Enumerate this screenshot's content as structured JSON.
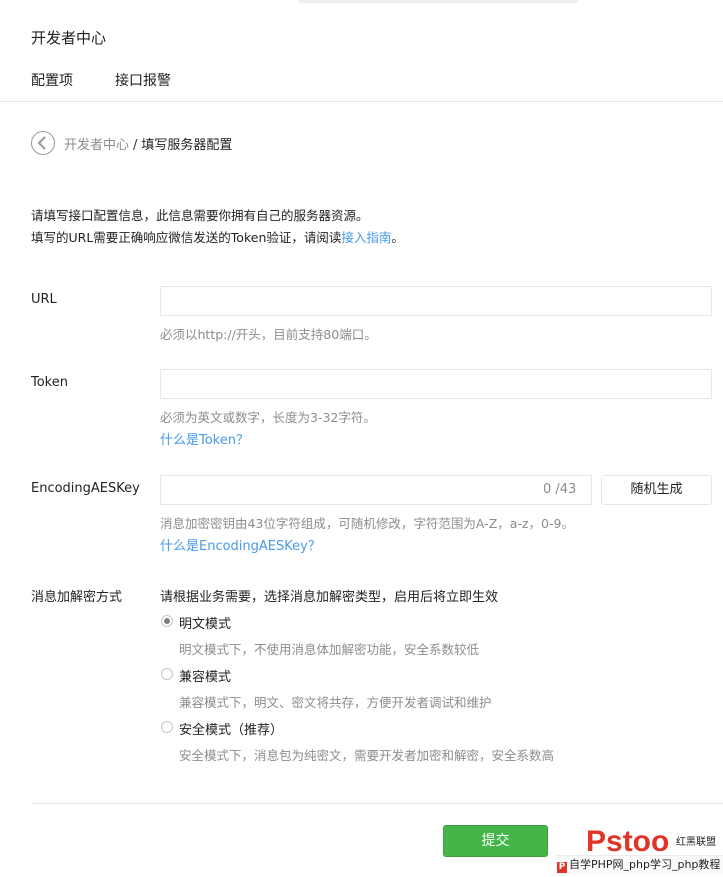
{
  "page": {
    "title": "开发者中心"
  },
  "tabs": [
    {
      "label": "配置项",
      "active": true
    },
    {
      "label": "接口报警",
      "active": false
    }
  ],
  "breadcrumb": {
    "root": "开发者中心",
    "separator": "/",
    "current": "填写服务器配置"
  },
  "intro": {
    "line1": "请填写接口配置信息，此信息需要你拥有自己的服务器资源。",
    "line2_prefix": "填写的URL需要正确响应微信发送的Token验证，请阅读",
    "line2_link": "接入指南",
    "line2_suffix": "。"
  },
  "form": {
    "url": {
      "label": "URL",
      "value": "",
      "tip": "必须以http://开头，目前支持80端口。"
    },
    "token": {
      "label": "Token",
      "value": "",
      "tip": "必须为英文或数字，长度为3-32字符。",
      "help_link": "什么是Token？"
    },
    "aes": {
      "label": "EncodingAESKey",
      "value": "",
      "counter": "0 /43",
      "generate_button": "随机生成",
      "tip": "消息加密密钥由43位字符组成，可随机修改，字符范围为A-Z，a-z，0-9。",
      "help_link": "什么是EncodingAESKey？"
    },
    "encryption": {
      "label": "消息加解密方式",
      "hint": "请根据业务需要，选择消息加解密类型，启用后将立即生效",
      "options": [
        {
          "label": "明文模式",
          "desc": "明文模式下，不使用消息体加解密功能，安全系数较低",
          "checked": true
        },
        {
          "label": "兼容模式",
          "desc": "兼容模式下，明文、密文将共存，方便开发者调试和维护",
          "checked": false
        },
        {
          "label": "安全模式（推荐）",
          "desc": "安全模式下，消息包为纯密文，需要开发者加密和解密，安全系数高",
          "checked": false
        }
      ]
    }
  },
  "submit_label": "提交",
  "watermark": {
    "logo_text": "Pstoo",
    "side_text": "红黑联盟",
    "bar_icon": "P",
    "bar_text": "自学PHP网_php学习_php教程"
  },
  "colors": {
    "accent": "#44b549",
    "link": "#459ae9",
    "muted": "#8d8d8d",
    "border": "#e7e7eb"
  }
}
